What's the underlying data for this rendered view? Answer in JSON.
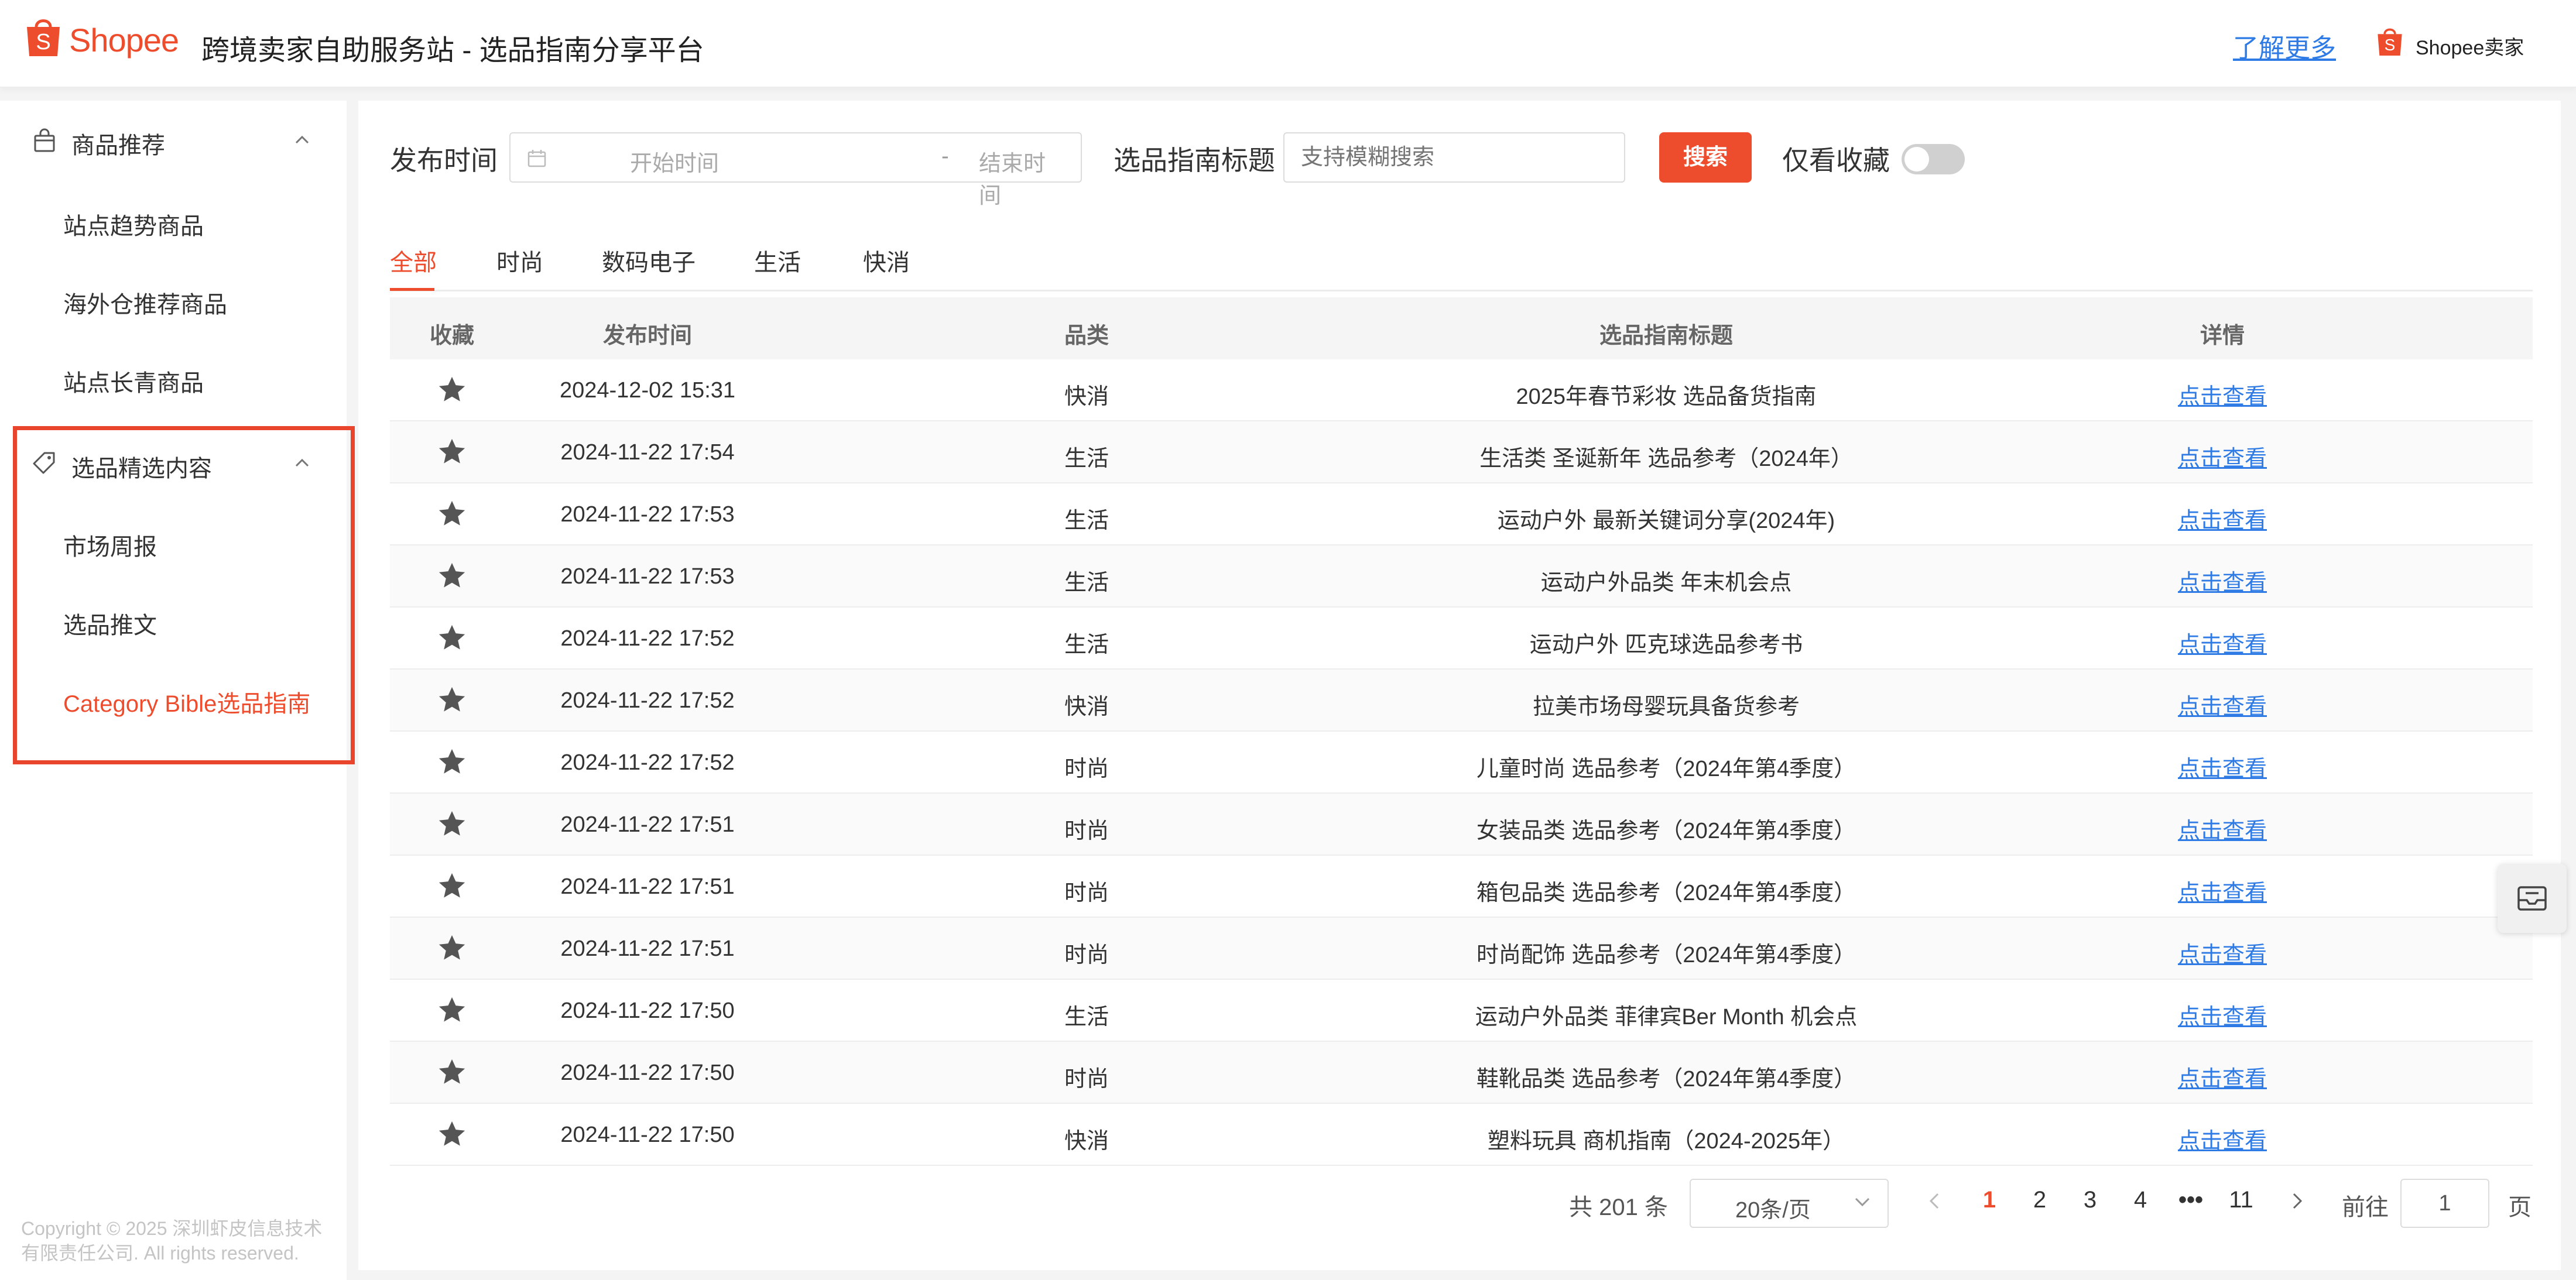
{
  "header": {
    "logo_text": "Shopee",
    "title": "跨境卖家自助服务站 - 选品指南分享平台",
    "learn_more": "了解更多",
    "seller_label": "Shopee卖家"
  },
  "sidebar": {
    "group1": {
      "label": "商品推荐",
      "icon": "shopping-bag-icon"
    },
    "group1_items": [
      {
        "label": "站点趋势商品"
      },
      {
        "label": "海外仓推荐商品"
      },
      {
        "label": "站点长青商品"
      }
    ],
    "group2": {
      "label": "选品精选内容",
      "icon": "tag-icon"
    },
    "group2_items": [
      {
        "label": "市场周报"
      },
      {
        "label": "选品推文"
      },
      {
        "label": "Category Bible选品指南"
      }
    ],
    "copyright": "Copyright © 2025 深圳虾皮信息技术有限责任公司. All rights reserved."
  },
  "filters": {
    "publish_time_label": "发布时间",
    "start_placeholder": "开始时间",
    "separator": "-",
    "end_placeholder": "结束时间",
    "title_label": "选品指南标题",
    "title_placeholder": "支持模糊搜索",
    "search_button": "搜索",
    "favorites_only_label": "仅看收藏"
  },
  "tabs": [
    "全部",
    "时尚",
    "数码电子",
    "生活",
    "快消"
  ],
  "table": {
    "headers": [
      "收藏",
      "发布时间",
      "品类",
      "选品指南标题",
      "详情"
    ],
    "rows": [
      {
        "time": "2024-12-02 15:31",
        "category": "快消",
        "title": "2025年春节彩妆 选品备货指南",
        "link": "点击查看"
      },
      {
        "time": "2024-11-22 17:54",
        "category": "生活",
        "title": "生活类 圣诞新年 选品参考（2024年）",
        "link": "点击查看"
      },
      {
        "time": "2024-11-22 17:53",
        "category": "生活",
        "title": "运动户外 最新关键词分享(2024年)",
        "link": "点击查看"
      },
      {
        "time": "2024-11-22 17:53",
        "category": "生活",
        "title": "运动户外品类 年末机会点",
        "link": "点击查看"
      },
      {
        "time": "2024-11-22 17:52",
        "category": "生活",
        "title": "运动户外 匹克球选品参考书",
        "link": "点击查看"
      },
      {
        "time": "2024-11-22 17:52",
        "category": "快消",
        "title": "拉美市场母婴玩具备货参考",
        "link": "点击查看"
      },
      {
        "time": "2024-11-22 17:52",
        "category": "时尚",
        "title": "儿童时尚 选品参考（2024年第4季度）",
        "link": "点击查看"
      },
      {
        "time": "2024-11-22 17:51",
        "category": "时尚",
        "title": "女装品类 选品参考（2024年第4季度）",
        "link": "点击查看"
      },
      {
        "time": "2024-11-22 17:51",
        "category": "时尚",
        "title": "箱包品类 选品参考（2024年第4季度）",
        "link": "点击查看"
      },
      {
        "time": "2024-11-22 17:51",
        "category": "时尚",
        "title": "时尚配饰 选品参考（2024年第4季度）",
        "link": "点击查看"
      },
      {
        "time": "2024-11-22 17:50",
        "category": "生活",
        "title": "运动户外品类 菲律宾Ber Month 机会点",
        "link": "点击查看"
      },
      {
        "time": "2024-11-22 17:50",
        "category": "时尚",
        "title": "鞋靴品类 选品参考（2024年第4季度）",
        "link": "点击查看"
      },
      {
        "time": "2024-11-22 17:50",
        "category": "快消",
        "title": "塑料玩具 商机指南（2024-2025年）",
        "link": "点击查看"
      }
    ]
  },
  "pagination": {
    "total": "共 201 条",
    "page_size": "20条/页",
    "pages": [
      "1",
      "2",
      "3",
      "4",
      "•••",
      "11"
    ],
    "current": "1",
    "goto_label": "前往",
    "goto_value": "1",
    "page_suffix": "页"
  },
  "colors": {
    "accent": "#ee4d2d",
    "link": "#2f7be5",
    "highlight": "#e8452c"
  }
}
